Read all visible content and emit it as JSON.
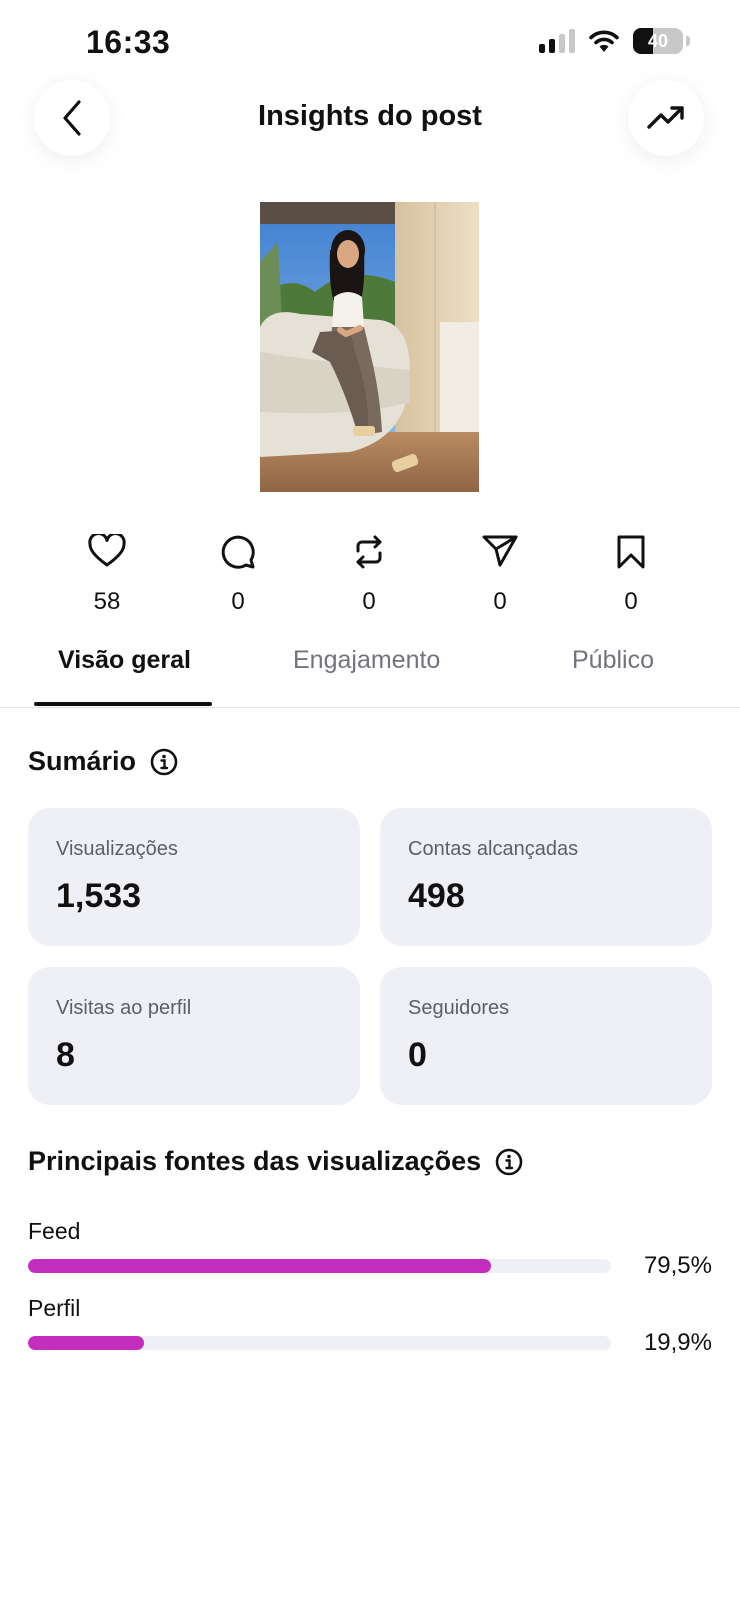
{
  "status_bar": {
    "time": "16:33",
    "battery": "40",
    "battery_level": 0.4
  },
  "header": {
    "title": "Insights do post"
  },
  "stats": [
    {
      "icon": "heart-icon",
      "value": "58"
    },
    {
      "icon": "comment-icon",
      "value": "0"
    },
    {
      "icon": "repost-icon",
      "value": "0"
    },
    {
      "icon": "share-icon",
      "value": "0"
    },
    {
      "icon": "bookmark-icon",
      "value": "0"
    }
  ],
  "tabs": [
    {
      "label": "Visão geral",
      "active": true
    },
    {
      "label": "Engajamento",
      "active": false
    },
    {
      "label": "Público",
      "active": false
    }
  ],
  "summary": {
    "title": "Sumário",
    "cards": [
      {
        "label": "Visualizações",
        "value": "1,533"
      },
      {
        "label": "Contas alcançadas",
        "value": "498"
      },
      {
        "label": "Visitas ao perfil",
        "value": "8"
      },
      {
        "label": "Seguidores",
        "value": "0"
      }
    ]
  },
  "sources": {
    "title": "Principais fontes das visualizações",
    "accent_color": "#c42ebf",
    "items": [
      {
        "label": "Feed",
        "percent_text": "79,5%",
        "fraction": 0.795
      },
      {
        "label": "Perfil",
        "percent_text": "19,9%",
        "fraction": 0.199
      }
    ]
  }
}
